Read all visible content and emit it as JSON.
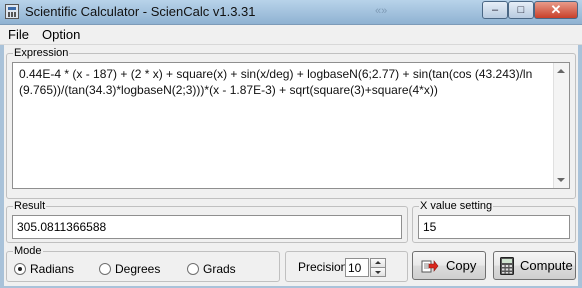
{
  "window": {
    "title": "Scientific Calculator - ScienCalc v1.3.31",
    "background_hint": "«»",
    "controls": {
      "minimize": "–",
      "maximize": "□",
      "close": "✕"
    }
  },
  "menu": {
    "items": [
      "File",
      "Option"
    ]
  },
  "expression": {
    "label": "Expression",
    "value": "0.44E-4 * (x - 187) + (2 * x) + square(x) + sin(x/deg) + logbaseN(6;2.77) + sin(tan(cos (43.243)/ln(9.765))/(tan(34.3)*logbaseN(2;3)))*(x - 1.87E-3) + sqrt(square(3)+square(4*x))"
  },
  "result": {
    "label": "Result",
    "value": "305.0811366588"
  },
  "x_value": {
    "label": "X value setting",
    "value": "15"
  },
  "mode": {
    "label": "Mode",
    "options": [
      "Radians",
      "Degrees",
      "Grads"
    ],
    "selected": "Radians"
  },
  "precision": {
    "label": "Precision",
    "value": "10"
  },
  "buttons": {
    "copy": "Copy",
    "compute": "Compute"
  },
  "icons": {
    "app": "calculator-app-icon",
    "copy": "copy-arrow-icon",
    "compute": "calculator-icon"
  },
  "colors": {
    "title_gradient_top": "#b8d3ea",
    "title_gradient_bottom": "#8fb2d2",
    "close_button": "#c8402a",
    "copy_arrow": "#d9261c"
  }
}
